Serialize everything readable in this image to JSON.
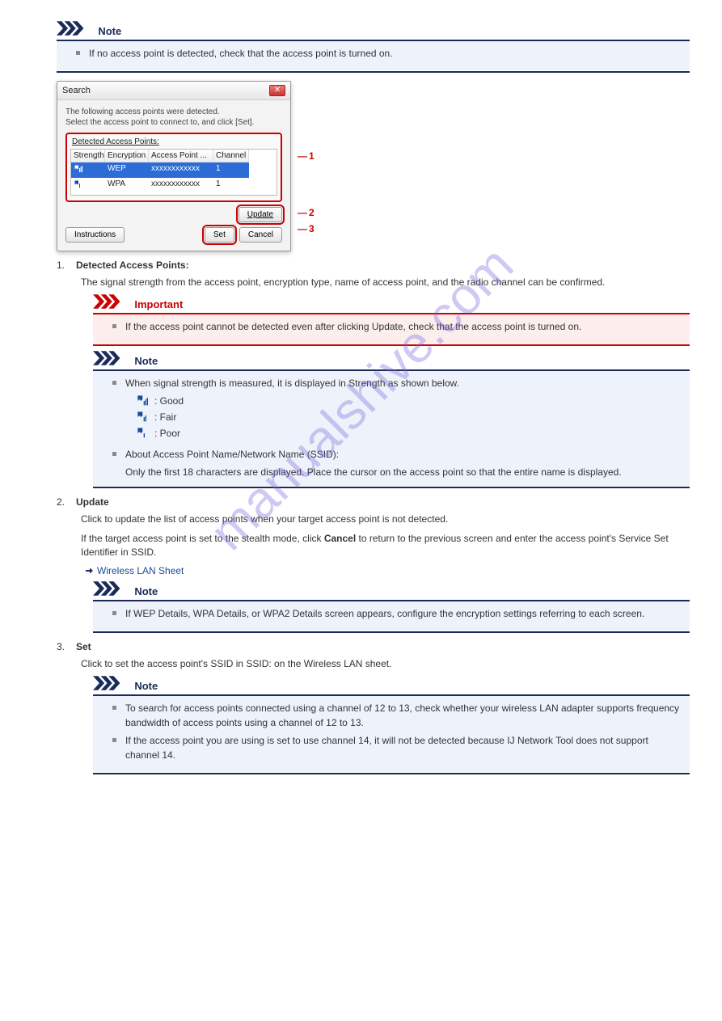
{
  "watermark": "manualshive.com",
  "notes": {
    "note_label": "Note",
    "important_label": "Important",
    "n1_text": "If no access point is detected, check that the access point is turned on.",
    "imp1_text": "If the access point cannot be detected even after clicking Update, check that the access point is turned on.",
    "n2_text": "When signal strength is measured, it is displayed in Strength as shown below.",
    "sig_good": ": Good",
    "sig_fair": ": Fair",
    "sig_poor": ": Poor",
    "note2_ap_text": "About Access Point Name/Network Name (SSID):",
    "note2_ap_sub": "Only the first 18 characters are displayed. Place the cursor on the access point so that the entire name is displayed.",
    "n3_text": "If WEP Details, WPA Details, or WPA2 Details screen appears, configure the encryption settings referring to each screen.",
    "n4_item1": "To search for access points connected using a channel of 12 to 13, check whether your wireless LAN adapter supports frequency bandwidth of access points using a channel of 12 to 13.",
    "n4_item2": "If the access point you are using is set to use channel 14, it will not be detected because IJ Network Tool does not support channel 14."
  },
  "dialog": {
    "title": "Search",
    "intro1": "The following access points were detected.",
    "intro2": "Select the access point to connect to, and click [Set].",
    "group_label": "Detected Access Points:",
    "cols": {
      "c1": "Strength",
      "c2": "Encryption",
      "c3": "Access Point ...",
      "c4": "Channel"
    },
    "row1": {
      "enc": "WEP",
      "ap": "xxxxxxxxxxxx",
      "ch": "1"
    },
    "row2": {
      "enc": "WPA",
      "ap": "xxxxxxxxxxxx",
      "ch": "1"
    },
    "btn_update": "Update",
    "btn_inst": "Instructions",
    "btn_set": "Set",
    "btn_cancel": "Cancel",
    "tag1": "1",
    "tag2": "2",
    "tag3": "3"
  },
  "items": {
    "i1_n": "1.",
    "i1_h": "Detected Access Points:",
    "i1_t": "The signal strength from the access point, encryption type, name of access point, and the radio channel can be confirmed.",
    "i2_n": "2.",
    "i2_h": "Update",
    "i2_t": "Click to update the list of access points when your target access point is not detected.",
    "i2_t2a": "If the target access point is set to the stealth mode, click ",
    "i2_cancel": "Cancel",
    "i2_t2b": " to return to the previous screen and enter the access point's Service Set Identifier in SSID.",
    "i2_link": "Wireless LAN Sheet",
    "i3_n": "3.",
    "i3_h": "Set",
    "i3_t": "Click to set the access point's SSID in SSID: on the Wireless LAN sheet."
  }
}
